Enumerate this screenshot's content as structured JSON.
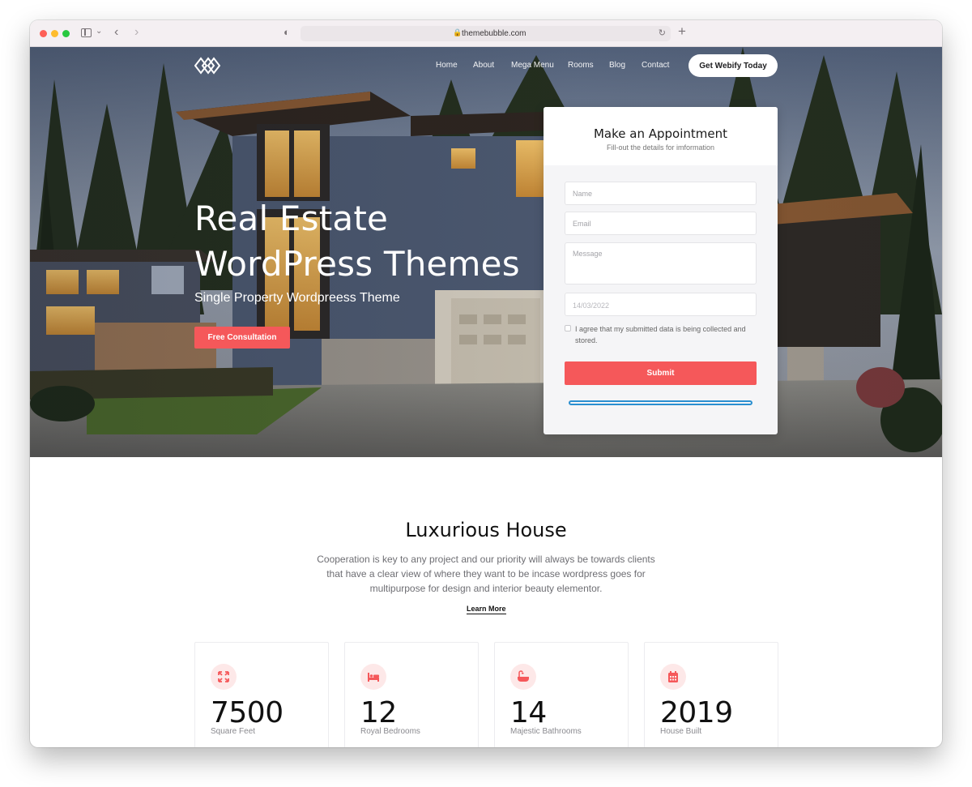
{
  "browser": {
    "url": "themebubble.com"
  },
  "nav": {
    "items": [
      "Home",
      "About",
      "Mega Menu",
      "Rooms",
      "Blog",
      "Contact"
    ],
    "cta": "Get Webify Today"
  },
  "hero": {
    "title": "Real Estate WordPress Themes",
    "subtitle": "Single Property Wordpreess Theme",
    "button": "Free Consultation"
  },
  "appointment": {
    "title": "Make an Appointment",
    "subtitle": "Fill-out the details for imformation",
    "name_placeholder": "Name",
    "email_placeholder": "Email",
    "message_placeholder": "Message",
    "date_value": "14/03/2022",
    "agree_text": "I agree that my submitted data is being collected and stored.",
    "submit": "Submit"
  },
  "section": {
    "title": "Luxurious House",
    "body": "Cooperation is key to any project and our priority will always be towards clients that have a clear view of where they want to be incase wordpress goes for multipurpose for design and interior beauty elementor.",
    "link": "Learn More"
  },
  "stats": [
    {
      "value": "7500",
      "label": "Square Feet",
      "icon": "expand-arrows-icon"
    },
    {
      "value": "12",
      "label": "Royal Bedrooms",
      "icon": "bed-icon"
    },
    {
      "value": "14",
      "label": "Majestic Bathrooms",
      "icon": "bathtub-icon"
    },
    {
      "value": "2019",
      "label": "House Built",
      "icon": "calendar-icon"
    }
  ],
  "colors": {
    "accent": "#f5585a",
    "accent_light": "#fde8e8",
    "text_dark": "#111111",
    "text_muted": "#6e6e73"
  }
}
